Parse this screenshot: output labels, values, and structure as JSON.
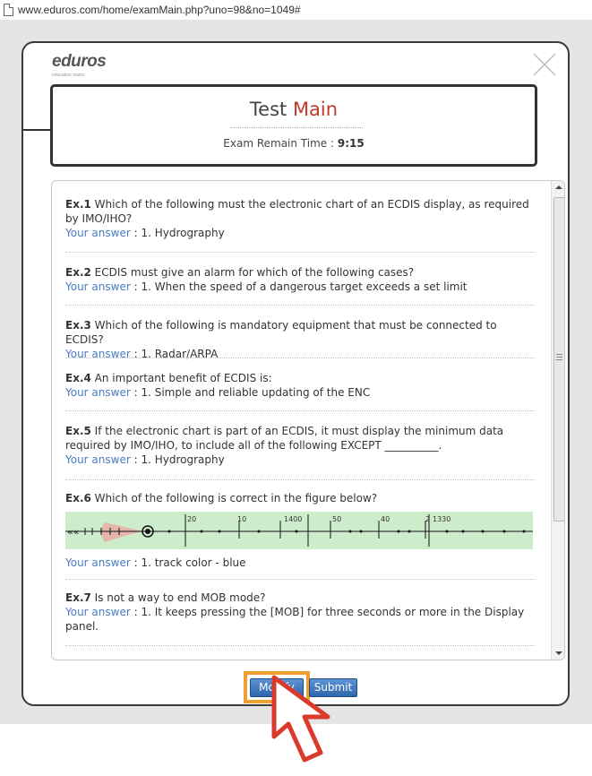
{
  "browser": {
    "url": "www.eduros.com/home/examMain.php?uno=98&no=1049#"
  },
  "brand": {
    "logo": "eduros",
    "tagline": "education matrix"
  },
  "header": {
    "title_main": "Test ",
    "title_accent": "Main",
    "remain_label": "Exam Remain Time : ",
    "remain_value": "9:15"
  },
  "questions": [
    {
      "num": "Ex.1",
      "text": " Which of the following must the electronic chart of an ECDIS display, as required",
      "text2": "by IMO/IHO?",
      "answer_label": "Your answer",
      "answer": " : 1. Hydrography"
    },
    {
      "num": "Ex.2",
      "text": " ECDIS must give an alarm for which of the following cases?",
      "answer_label": "Your answer",
      "answer": " : 1. When the speed of a dangerous target exceeds a set limit"
    },
    {
      "num": "Ex.3",
      "text": " Which of the following is mandatory equipment that must be connected to ECDIS?",
      "answer_label": "Your answer",
      "answer": " : 1. Radar/ARPA"
    },
    {
      "num": "Ex.4",
      "text": " An important benefit of ECDIS is:",
      "answer_label": "Your answer",
      "answer": " : 1. Simple and reliable updating of the ENC"
    },
    {
      "num": "Ex.5",
      "text": " If the electronic chart is part of an ECDIS, it must display the minimum data",
      "text2": "required by IMO/IHO, to include all of the following EXCEPT __________.",
      "answer_label": "Your answer",
      "answer": " : 1. Hydrography"
    },
    {
      "num": "Ex.6",
      "text": " Which of the following is correct in the figure below?",
      "answer_label": "Your answer",
      "answer": " : 1. track color - blue",
      "figure_labels": [
        "20",
        "10",
        "1400",
        "50",
        "40",
        "2",
        "1330"
      ]
    },
    {
      "num": "Ex.7",
      "text": " Is not a way to end MOB mode?",
      "answer_label": "Your answer",
      "answer": " : 1. It keeps pressing the [MOB] for three seconds or more in the Display",
      "answer2": "panel."
    }
  ],
  "buttons": {
    "modify": "Modify",
    "submit": "Submit"
  },
  "colors": {
    "accent_red": "#c0392b",
    "answer_blue": "#4a7cc2",
    "button_blue": "#3a72b8",
    "highlight_orange": "#f0a030",
    "cursor_red": "#d93a2b"
  }
}
